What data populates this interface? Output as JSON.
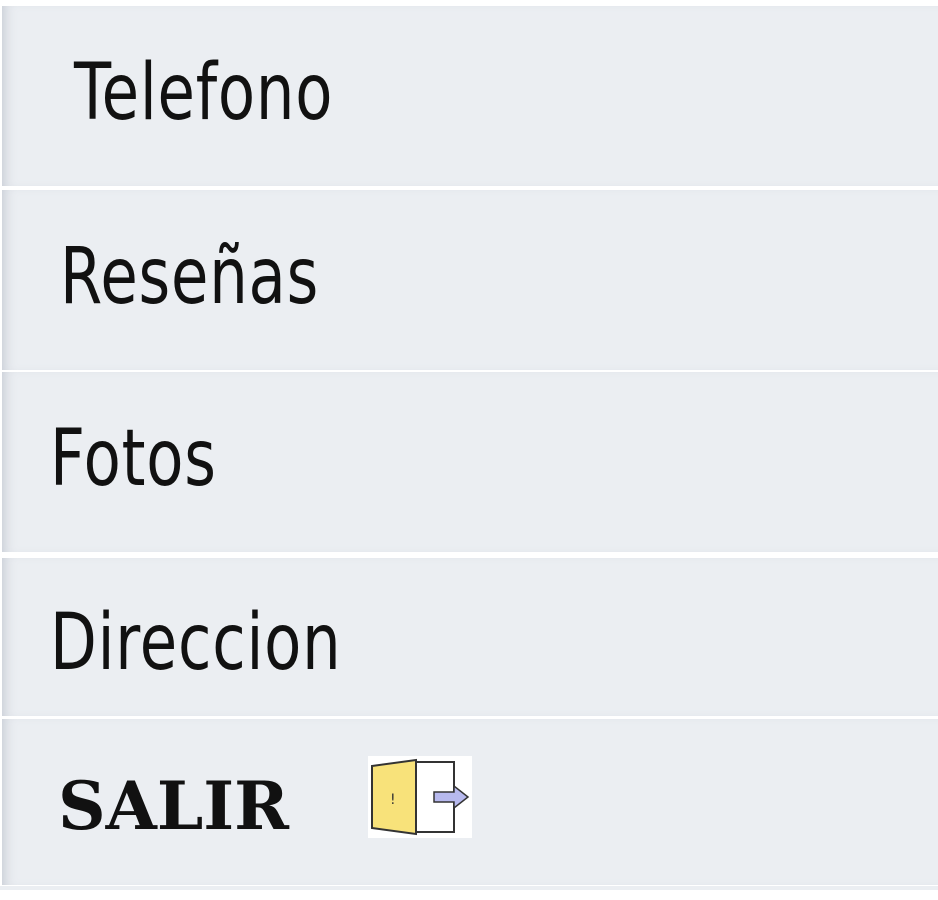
{
  "menu": {
    "items": [
      {
        "label": "Telefono"
      },
      {
        "label": "Reseñas"
      },
      {
        "label": "Fotos"
      },
      {
        "label": "Direccion"
      }
    ],
    "exit": {
      "label": "SALIR",
      "icon": "exit-door-icon"
    }
  },
  "colors": {
    "item_background": "#ebeef2",
    "text": "#111111",
    "door": "#f8e27a",
    "arrow": "#b7b9ee"
  }
}
